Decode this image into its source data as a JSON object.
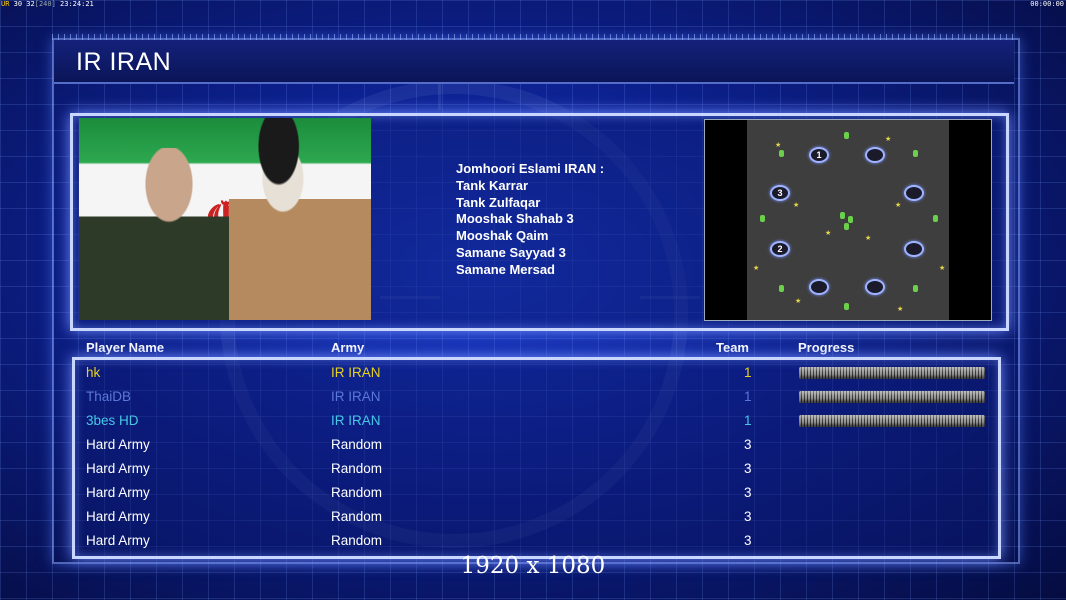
{
  "status_bar": {
    "left_prefix": "UR",
    "left_nums": "30 32",
    "left_bracket": "[240]",
    "left_time": "23:24:21",
    "right_time": "00:00:00"
  },
  "header": {
    "title": "IR IRAN"
  },
  "army_info": {
    "lines": [
      "Jomhoori Eslami IRAN :",
      "Tank Karrar",
      "Tank Zulfaqar",
      "Mooshak Shahab 3",
      "Mooshak Qaim",
      "Samane Sayyad 3",
      "Samane Mersad"
    ]
  },
  "map": {
    "start_positions": [
      "1",
      "",
      "3",
      "",
      "2",
      "",
      "",
      ""
    ]
  },
  "table": {
    "headers": {
      "player": "Player Name",
      "army": "Army",
      "team": "Team",
      "progress": "Progress"
    },
    "rows": [
      {
        "name": "hk",
        "army": "IR IRAN",
        "team": "1",
        "color": "#e8d21a",
        "progress": 1.0
      },
      {
        "name": "ThaiDB",
        "army": "IR IRAN",
        "team": "1",
        "color": "#5a78d8",
        "progress": 1.0
      },
      {
        "name": "3bes HD",
        "army": "IR IRAN",
        "team": "1",
        "color": "#46c8e6",
        "progress": 1.0
      },
      {
        "name": "Hard Army",
        "army": "Random",
        "team": "3",
        "color": "#ffffff"
      },
      {
        "name": "Hard Army",
        "army": "Random",
        "team": "3",
        "color": "#ffffff"
      },
      {
        "name": "Hard Army",
        "army": "Random",
        "team": "3",
        "color": "#ffffff"
      },
      {
        "name": "Hard Army",
        "army": "Random",
        "team": "3",
        "color": "#ffffff"
      },
      {
        "name": "Hard Army",
        "army": "Random",
        "team": "3",
        "color": "#ffffff"
      }
    ]
  },
  "resolution": "1920 x 1080"
}
